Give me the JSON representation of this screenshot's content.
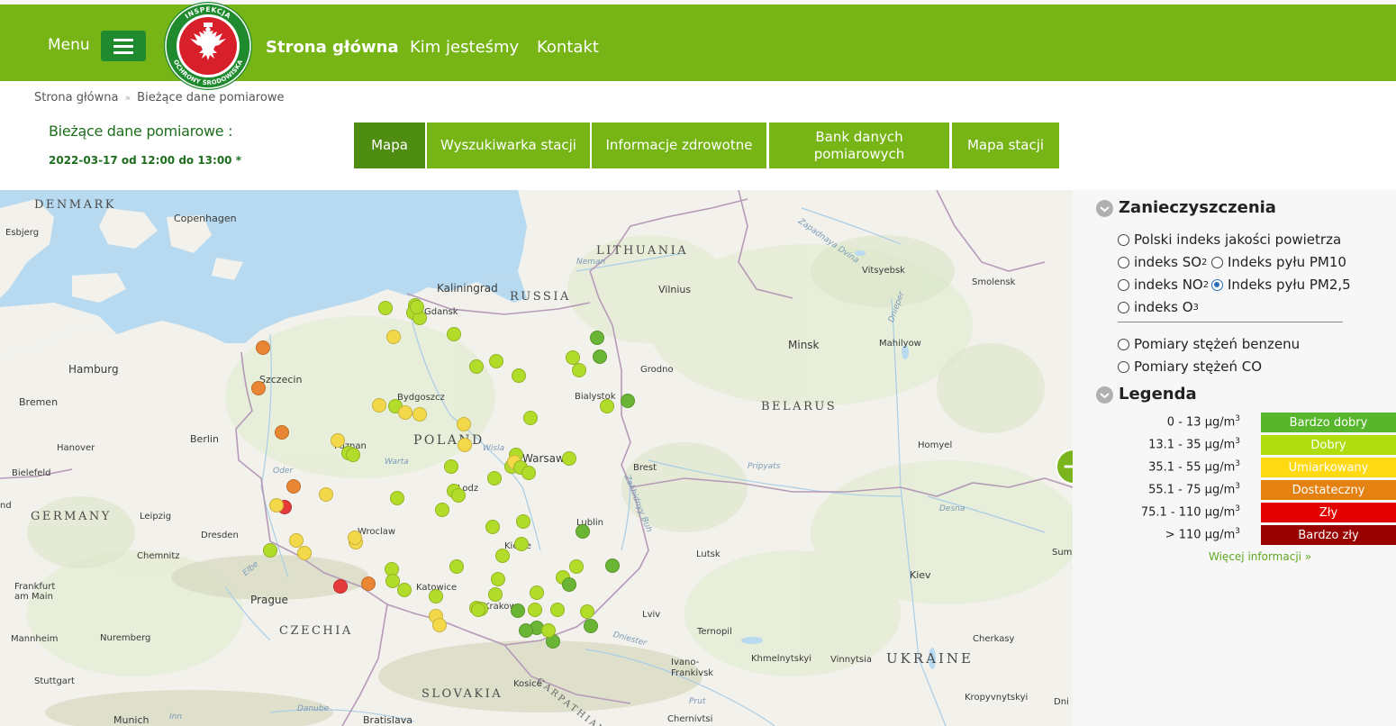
{
  "header": {
    "menu_label": "Menu",
    "logo_top_text": "INSPEKCJA",
    "logo_bottom_text": "OCHRONY ŚRODOWISKA",
    "nav": [
      {
        "label": "Strona główna"
      },
      {
        "label": "Kim jesteśmy"
      },
      {
        "label": "Kontakt"
      }
    ],
    "colors": {
      "bar": "#76b515",
      "menu_button": "#1f8a2e"
    }
  },
  "breadcrumb": {
    "items": [
      "Strona główna",
      "Bieżące dane pomiarowe"
    ],
    "separator": "»"
  },
  "title": {
    "heading": "Bieżące dane pomiarowe :",
    "date_range": "2022-03-17 od 12:00 do 13:00 *"
  },
  "tabs": [
    {
      "label": "Mapa",
      "active": true
    },
    {
      "label": "Wyszukiwarka stacji",
      "active": false
    },
    {
      "label": "Informacje zdrowotne",
      "active": false
    },
    {
      "label": "Bank danych pomiarowych",
      "active": false
    },
    {
      "label": "Mapa stacji",
      "active": false
    }
  ],
  "map": {
    "country_labels": [
      "DENMARK",
      "LITHUANIA",
      "RUSSIA",
      "POLAND",
      "BELARUS",
      "GERMANY",
      "CZECHIA",
      "SLOVAKIA",
      "UKRAINE",
      "CARPATHIAN"
    ],
    "city_labels": [
      "Copenhagen",
      "Esbjerg",
      "Kaliningrad",
      "Vilnius",
      "Vitsyebsk",
      "Smolensk",
      "Gdansk",
      "Hamburg",
      "Szczecin",
      "Bremen",
      "Minsk",
      "Mahilyow",
      "Grodno",
      "Bialystok",
      "Bydgoszcz",
      "Hanover",
      "Berlin",
      "Poznan",
      "Bielefeld",
      "Warsaw",
      "Homyel",
      "Brest",
      "Lodz",
      "Leipzig",
      "Lublin",
      "Wroclaw",
      "Dresden",
      "Kielce",
      "Chemnitz",
      "Lutsk",
      "Katowice",
      "Frankfurt am Main",
      "Prague",
      "Kiev",
      "Krakow",
      "Lviv",
      "Ternopil",
      "Mannheim",
      "Nuremberg",
      "Ivano-Frankivsk",
      "Khmelnytskyi",
      "Vinnytsia",
      "Cherkasy",
      "Stuttgart",
      "Kosice",
      "Kropyvnytskyi",
      "Munich",
      "Bratislava",
      "Chernivtsi",
      "Sum",
      "Dni",
      "nd"
    ],
    "river_labels": [
      "Neman",
      "Zapadnaya Dvina",
      "Dnieper",
      "Wisla",
      "Warta",
      "Oder",
      "Pripyats",
      "Zakhidnyy Buh",
      "Desna",
      "Elbe",
      "Dniester",
      "Danube",
      "Prut",
      "Inn"
    ],
    "stations": [
      {
        "level": "dobry"
      },
      {
        "level": "dobry"
      },
      {
        "level": "dobry"
      },
      {
        "level": "dobry"
      },
      {
        "level": "dobry"
      },
      {
        "level": "umiarkowany"
      },
      {
        "level": "dostateczny"
      },
      {
        "level": "dostateczny"
      },
      {
        "level": "dobry"
      },
      {
        "level": "dobry"
      },
      {
        "level": "dobry"
      },
      {
        "level": "bardzo_dobry"
      },
      {
        "level": "bardzo_dobry"
      },
      {
        "level": "dobry"
      },
      {
        "level": "dobry"
      },
      {
        "level": "dobry"
      },
      {
        "level": "bardzo_dobry"
      },
      {
        "level": "dobry"
      },
      {
        "level": "umiarkowany"
      },
      {
        "level": "dobry"
      },
      {
        "level": "umiarkowany"
      },
      {
        "level": "umiarkowany"
      },
      {
        "level": "dobry"
      },
      {
        "level": "umiarkowany"
      },
      {
        "level": "dostateczny"
      },
      {
        "level": "umiarkowany"
      },
      {
        "level": "dobry"
      },
      {
        "level": "dobry"
      },
      {
        "level": "umiarkowany"
      },
      {
        "level": "dobry"
      },
      {
        "level": "dobry"
      },
      {
        "level": "umiarkowany"
      },
      {
        "level": "dobry"
      },
      {
        "level": "dobry"
      },
      {
        "level": "dobry"
      },
      {
        "level": "dobry"
      },
      {
        "level": "dobry"
      },
      {
        "level": "dobry"
      },
      {
        "level": "dostateczny"
      },
      {
        "level": "umiarkowany"
      },
      {
        "level": "zly"
      },
      {
        "level": "dobry"
      },
      {
        "level": "umiarkowany"
      },
      {
        "level": "dobry"
      },
      {
        "level": "dobry"
      },
      {
        "level": "dobry"
      },
      {
        "level": "dobry"
      },
      {
        "level": "bardzo_dobry"
      },
      {
        "level": "umiarkowany"
      },
      {
        "level": "dobry"
      },
      {
        "level": "umiarkowany"
      },
      {
        "level": "dobry"
      },
      {
        "level": "dobry"
      },
      {
        "level": "umiarkowany"
      },
      {
        "level": "umiarkowany"
      },
      {
        "level": "dobry"
      },
      {
        "level": "dobry"
      },
      {
        "level": "dobry"
      },
      {
        "level": "dobry"
      },
      {
        "level": "zly"
      },
      {
        "level": "dostateczny"
      },
      {
        "level": "dobry"
      },
      {
        "level": "dobry"
      },
      {
        "level": "dobry"
      },
      {
        "level": "bardzo_dobry"
      },
      {
        "level": "dobry"
      },
      {
        "level": "bardzo_dobry"
      },
      {
        "level": "dobry"
      },
      {
        "level": "dobry"
      },
      {
        "level": "dobry"
      },
      {
        "level": "umiarkowany"
      },
      {
        "level": "umiarkowany"
      },
      {
        "level": "dobry"
      },
      {
        "level": "dobry"
      },
      {
        "level": "bardzo_dobry"
      },
      {
        "level": "dobry"
      },
      {
        "level": "bardzo_dobry"
      },
      {
        "level": "bardzo_dobry"
      },
      {
        "level": "dobry"
      },
      {
        "level": "bardzo_dobry"
      },
      {
        "level": "dobry"
      },
      {
        "level": "dobry"
      },
      {
        "level": "bardzo_dobry"
      }
    ]
  },
  "panel": {
    "pollutants_heading": "Zanieczyszczenia",
    "legend_heading": "Legenda",
    "options": [
      {
        "label": "Polski indeks jakości powietrza",
        "selected": false
      },
      {
        "label": "indeks SO",
        "sub": "2",
        "selected": false
      },
      {
        "label": "Indeks pyłu PM10",
        "selected": false
      },
      {
        "label": "indeks NO",
        "sub": "2",
        "selected": false
      },
      {
        "label": "Indeks pyłu PM2,5",
        "selected": true
      },
      {
        "label": "indeks O",
        "sub": "3",
        "selected": false
      },
      {
        "label": "Pomiary stężeń benzenu",
        "selected": false
      },
      {
        "label": "Pomiary stężeń CO",
        "selected": false
      }
    ],
    "legend": [
      {
        "range": "0 - 13 μg/m",
        "label": "Bardzo dobry",
        "color": "#57b62b"
      },
      {
        "range": "13.1 - 35 μg/m",
        "label": "Dobry",
        "color": "#b0dd0d"
      },
      {
        "range": "35.1 - 55 μg/m",
        "label": "Umiarkowany",
        "color": "#ffd911"
      },
      {
        "range": "55.1 - 75 μg/m",
        "label": "Dostateczny",
        "color": "#e58110"
      },
      {
        "range": "75.1 - 110 μg/m",
        "label": "Zły",
        "color": "#e50000"
      },
      {
        "range": "> 110 μg/m",
        "label": "Bardzo zły",
        "color": "#990000"
      }
    ],
    "legend_unit_sup": "3",
    "more_link": "Więcej informacji »"
  },
  "level_colors": {
    "bardzo_dobry": "#6ab535",
    "dobry": "#b2dc2a",
    "umiarkowany": "#f3d94a",
    "dostateczny": "#e98634",
    "zly": "#e53a3a"
  }
}
